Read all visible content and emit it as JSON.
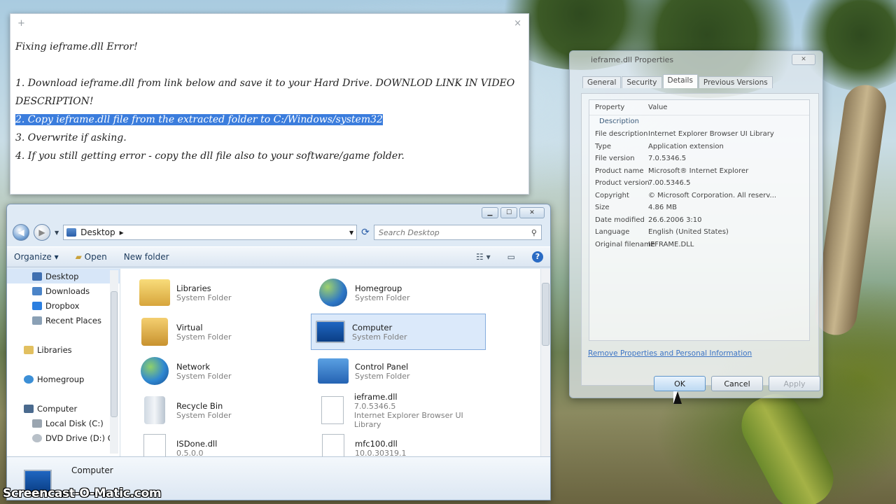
{
  "notepad": {
    "tab_plus": "+",
    "close_label": "×",
    "title_line": "Fixing ieframe.dll Error!",
    "step1": "1. Download ieframe.dll from link below and save it to your Hard Drive. DOWNLOD LINK IN VIDEO DESCRIPTION!",
    "step2": "2. Copy ieframe.dll file from the extracted folder to C:/Windows/system32",
    "step3": "3. Overwrite if asking.",
    "step4": "4. If you still getting error - copy the dll file also to your software/game folder."
  },
  "explorer": {
    "minimize": "▁",
    "maximize": "☐",
    "close": "✕",
    "address_path": "Desktop",
    "address_arrow": "▸",
    "search_placeholder": "Search Desktop",
    "toolbar": {
      "organize": "Organize ▾",
      "open": "Open",
      "new_folder": "New folder"
    },
    "nav_items": [
      "Desktop",
      "Downloads",
      "Dropbox",
      "Recent Places",
      "Libraries",
      "Homegroup",
      "Computer",
      "Local Disk (C:)",
      "DVD Drive (D:) GI"
    ],
    "tiles": [
      {
        "name": "Libraries",
        "sub1": "System Folder",
        "sub2": ""
      },
      {
        "name": "Homegroup",
        "sub1": "System Folder",
        "sub2": ""
      },
      {
        "name": "Virtual",
        "sub1": "System Folder",
        "sub2": ""
      },
      {
        "name": "Computer",
        "sub1": "System Folder",
        "sub2": ""
      },
      {
        "name": "Network",
        "sub1": "System Folder",
        "sub2": ""
      },
      {
        "name": "Control Panel",
        "sub1": "System Folder",
        "sub2": ""
      },
      {
        "name": "Recycle Bin",
        "sub1": "System Folder",
        "sub2": ""
      },
      {
        "name": "ieframe.dll",
        "sub1": "7.0.5346.5",
        "sub2": "Internet Explorer Browser UI Library"
      },
      {
        "name": "ISDone.dll",
        "sub1": "0.5.0.0",
        "sub2": ""
      },
      {
        "name": "mfc100.dll",
        "sub1": "10.0.30319.1",
        "sub2": ""
      }
    ],
    "details_name": "Computer"
  },
  "props": {
    "title": "ieframe.dll Properties",
    "close": "✕",
    "tabs": [
      "General",
      "Security",
      "Details",
      "Previous Versions"
    ],
    "col_property": "Property",
    "col_value": "Value",
    "section": "Description",
    "rows": [
      [
        "File description",
        "Internet Explorer Browser UI Library"
      ],
      [
        "Type",
        "Application extension"
      ],
      [
        "File version",
        "7.0.5346.5"
      ],
      [
        "Product name",
        "Microsoft® Internet Explorer"
      ],
      [
        "Product version",
        "7.00.5346.5"
      ],
      [
        "Copyright",
        "© Microsoft Corporation. All reserv..."
      ],
      [
        "Size",
        "4.86 MB"
      ],
      [
        "Date modified",
        "26.6.2006 3:10"
      ],
      [
        "Language",
        "English (United States)"
      ],
      [
        "Original filename",
        "IEFRAME.DLL"
      ]
    ],
    "link": "Remove Properties and Personal Information",
    "ok": "OK",
    "cancel": "Cancel",
    "apply": "Apply"
  },
  "watermark": "Screencast-O-Matic.com",
  "colors": {
    "accent": "#3b7ddd",
    "selection": "#dbe9fa",
    "link": "#3c74c4"
  }
}
